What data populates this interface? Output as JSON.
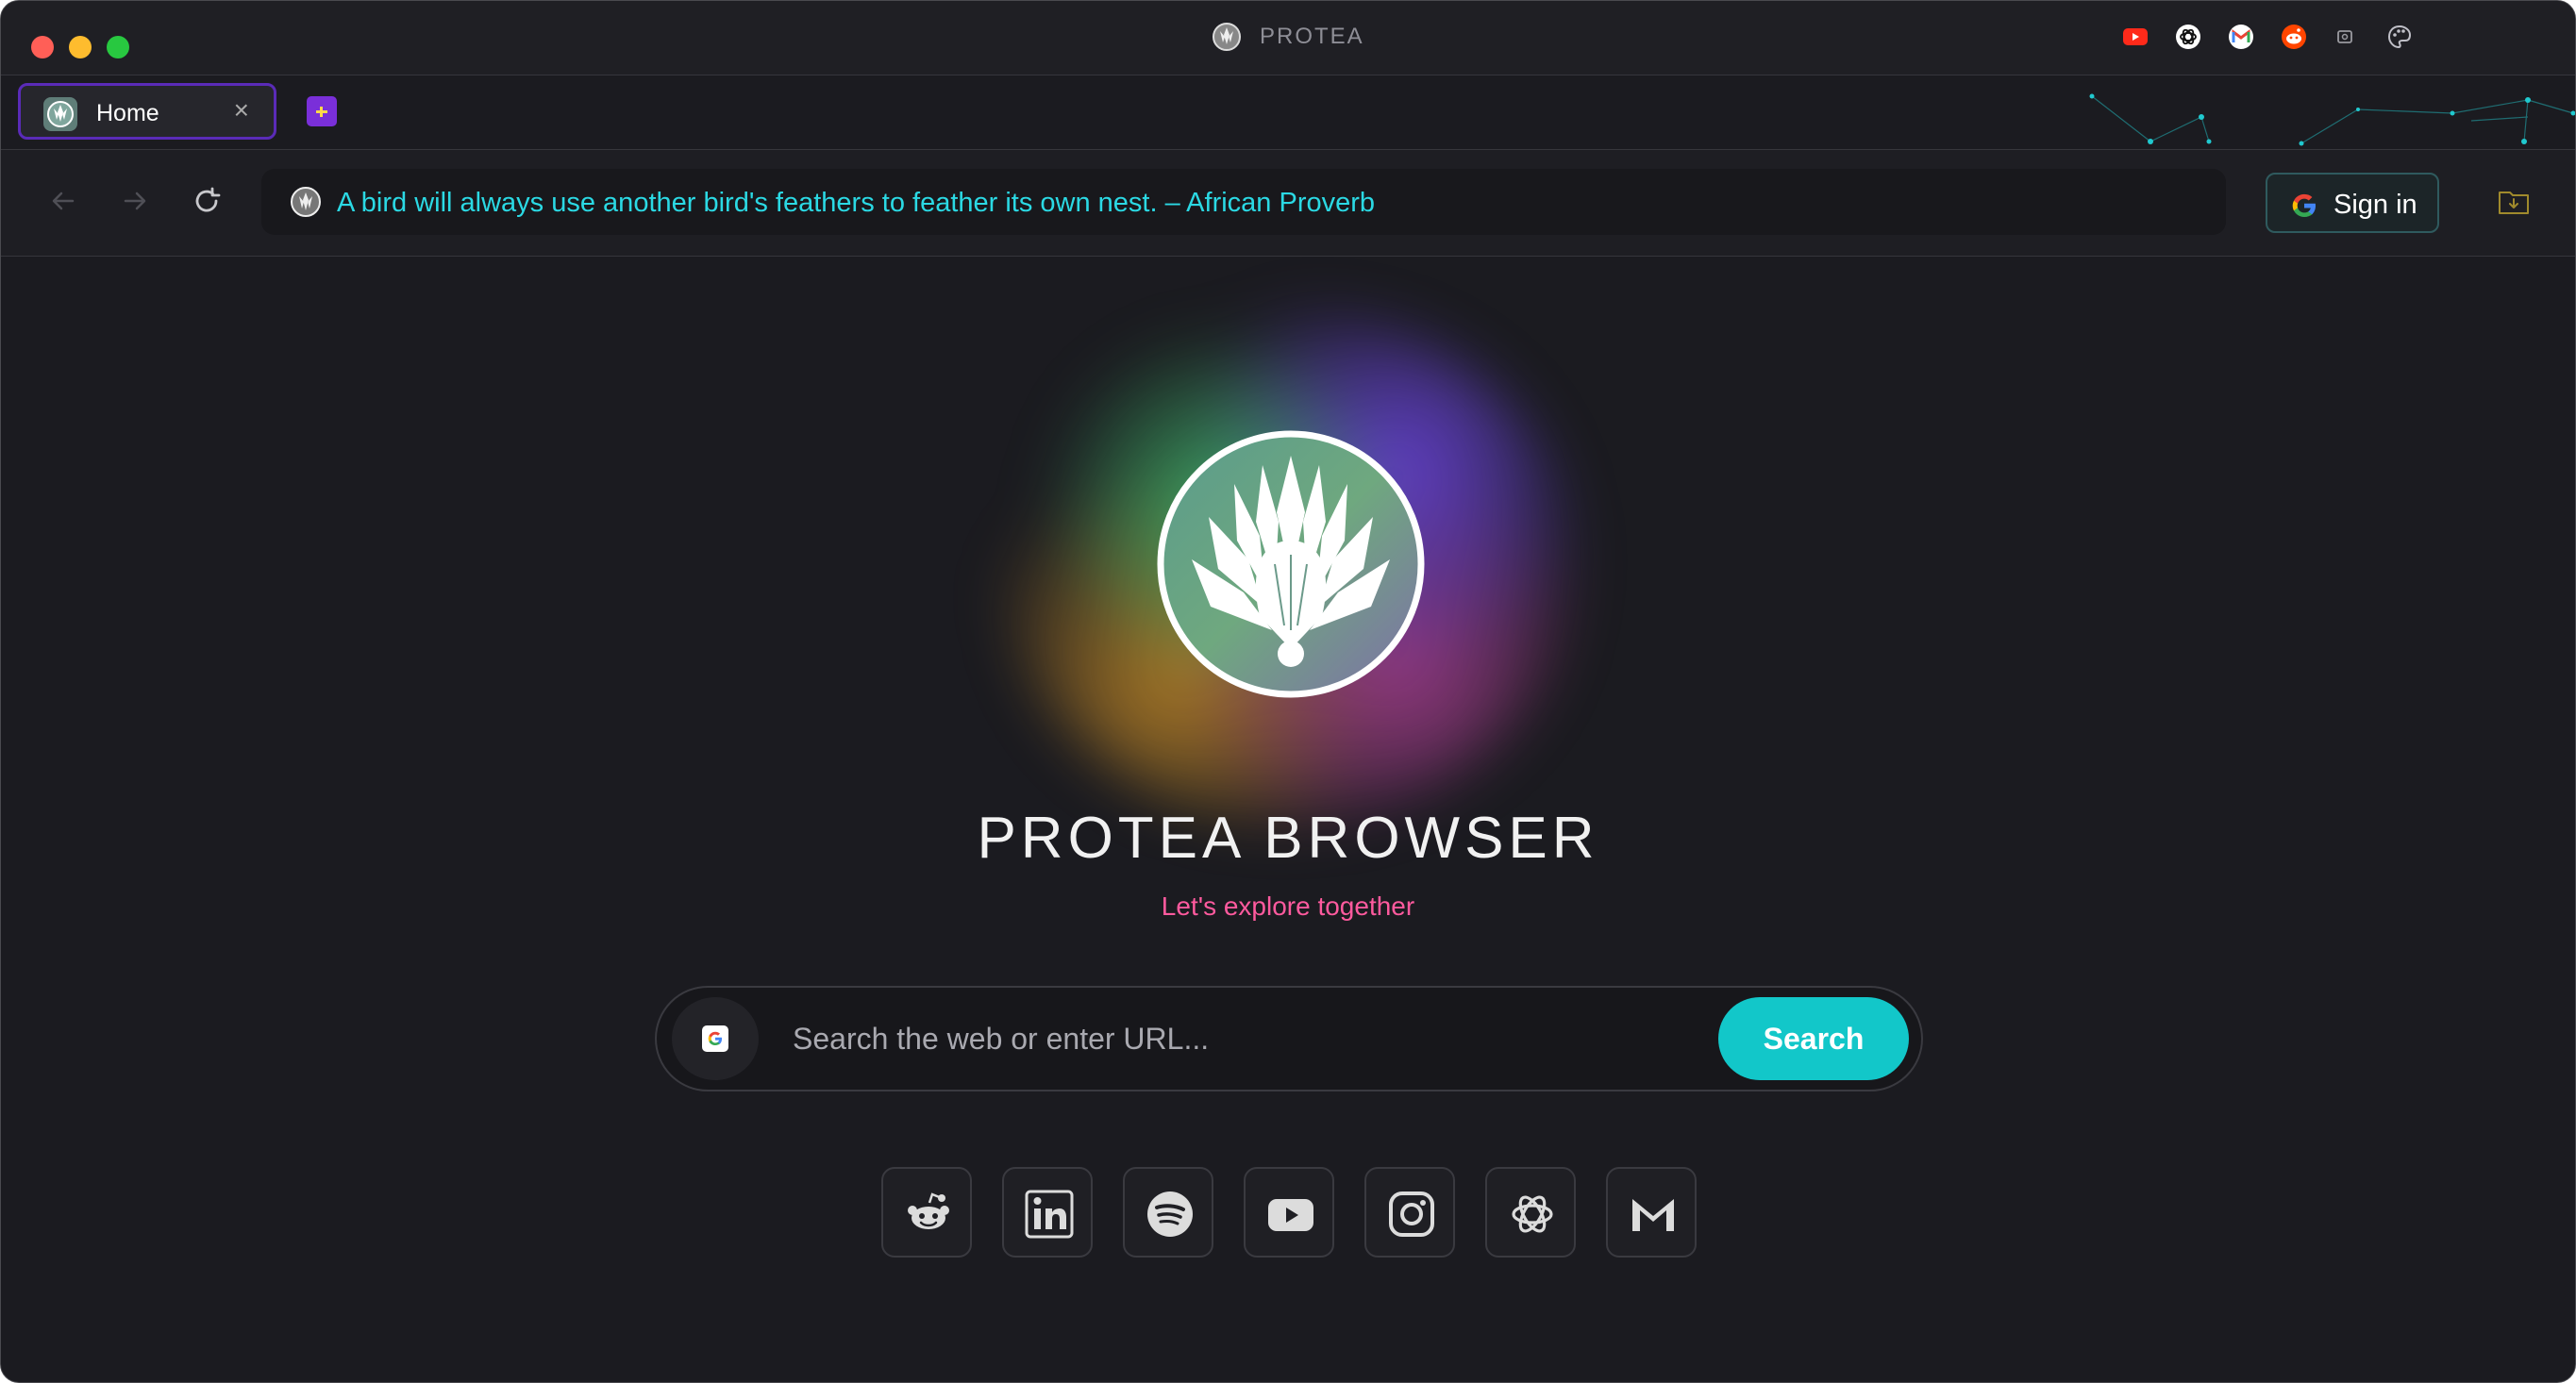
{
  "window": {
    "title": "PROTEA"
  },
  "quick_links": [
    {
      "icon": "youtube-icon",
      "color": "#ff2a1a"
    },
    {
      "icon": "openai-icon",
      "color": "#ffffff"
    },
    {
      "icon": "gmail-icon",
      "color": "#ea4335"
    },
    {
      "icon": "reddit-icon",
      "color": "#ff4500"
    },
    {
      "icon": "screenshot-icon",
      "color": "#9a9aa0"
    },
    {
      "icon": "palette-icon",
      "color": "#c0c0c8"
    }
  ],
  "tabs": [
    {
      "label": "Home",
      "active": true,
      "close": "×"
    }
  ],
  "address_bar": {
    "text": "A bird will always use another bird's feathers to feather its own nest. – African Proverb"
  },
  "signin": {
    "label": "Sign in"
  },
  "hero": {
    "brand": "PROTEA BROWSER",
    "tagline": "Let's explore together"
  },
  "search": {
    "placeholder": "Search the web or enter URL...",
    "button_label": "Search"
  },
  "shortcuts": [
    {
      "name": "reddit"
    },
    {
      "name": "linkedin"
    },
    {
      "name": "spotify"
    },
    {
      "name": "youtube"
    },
    {
      "name": "instagram"
    },
    {
      "name": "openai"
    },
    {
      "name": "gmail"
    }
  ],
  "colors": {
    "accent": "#12c7c9",
    "quote": "#2bd9e4",
    "tagline": "#ff5a9e",
    "tab_border": "#5a2bb8",
    "background": "#1b1b20"
  }
}
